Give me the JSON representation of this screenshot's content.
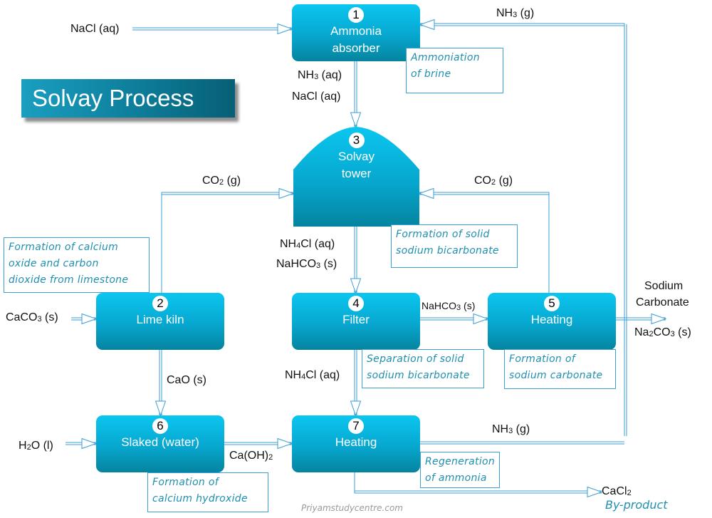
{
  "title": "Solvay Process",
  "colors": {
    "box_top": "#0bc6ef",
    "box_bottom": "#05849f",
    "arrow": "#3c9fd6",
    "note_text": "#1f8fb0",
    "banner": "#0d7d9a"
  },
  "units": [
    {
      "id": 1,
      "number": "1",
      "lines": [
        "Ammonia",
        "absorber"
      ]
    },
    {
      "id": 2,
      "number": "2",
      "lines": [
        "Lime kiln"
      ]
    },
    {
      "id": 3,
      "number": "3",
      "lines": [
        "Solvay",
        "tower"
      ]
    },
    {
      "id": 4,
      "number": "4",
      "lines": [
        "Filter"
      ]
    },
    {
      "id": 5,
      "number": "5",
      "lines": [
        "Heating"
      ]
    },
    {
      "id": 6,
      "number": "6",
      "lines": [
        "Slaked (water)"
      ]
    },
    {
      "id": 7,
      "number": "7",
      "lines": [
        "Heating"
      ]
    }
  ],
  "streams": {
    "nacl_in": {
      "pre": "NaCl (aq)"
    },
    "nh3_recycle_top": {
      "pre": "NH",
      "sub": "3",
      "post": " (g)"
    },
    "nh3_aq": {
      "pre": "NH",
      "sub": "3",
      "post": " (aq)"
    },
    "nacl_aq": {
      "pre": "NaCl (aq)"
    },
    "co2_left": {
      "pre": "CO",
      "sub": "2",
      "post": " (g)"
    },
    "co2_right": {
      "pre": "CO",
      "sub": "2",
      "post": " (g)"
    },
    "nh4cl_aq_1": {
      "pre": "NH",
      "sub": "4",
      "post": "Cl (aq)"
    },
    "nahco3_s_1": {
      "pre": "NaHCO",
      "sub": "3",
      "post": " (s)"
    },
    "nahco3_s_2": {
      "pre": "NaHCO",
      "sub": "3",
      "post": " (s)"
    },
    "caco3_in": {
      "pre": "CaCO",
      "sub": "3",
      "post": " (s)"
    },
    "sodium_carbonate_1": {
      "pre": "Sodium"
    },
    "sodium_carbonate_2": {
      "pre": "Carbonate"
    },
    "na2co3_out": {
      "pre": "Na",
      "sub": "2",
      "post": "CO3 (s)"
    },
    "cao": {
      "pre": "CaO (s)"
    },
    "nh4cl_aq_2": {
      "pre": "NH",
      "sub": "4",
      "post": "Cl (aq)"
    },
    "h2o_in": {
      "pre": "H",
      "sub": "2",
      "post": "O (l)"
    },
    "caoh2": {
      "pre": "Ca(OH)",
      "sub": "2",
      "post": ""
    },
    "nh3_g_bottom": {
      "pre": "NH",
      "sub": "3",
      "post": " (g)"
    },
    "cacl2_out": {
      "pre": "CaCl",
      "sub": "2",
      "post": ""
    }
  },
  "notes": {
    "ammoniation": [
      "Ammoniation",
      "of brine"
    ],
    "calcium_oxide": [
      "Formation of calcium",
      "oxide and carbon",
      "dioxide from limestone"
    ],
    "solid_bicarbonate": [
      "Formation of solid",
      "sodium bicarbonate"
    ],
    "separation": [
      "Separation of solid",
      "sodium bicarbonate"
    ],
    "sodium_carbonate": [
      "Formation of",
      "sodium carbonate"
    ],
    "calcium_hydroxide": [
      "Formation of",
      "calcium hydroxide"
    ],
    "regeneration": [
      "Regeneration",
      "of ammonia"
    ]
  },
  "byproduct_label": "By-product",
  "watermark": "Priyamstudycentre.com"
}
